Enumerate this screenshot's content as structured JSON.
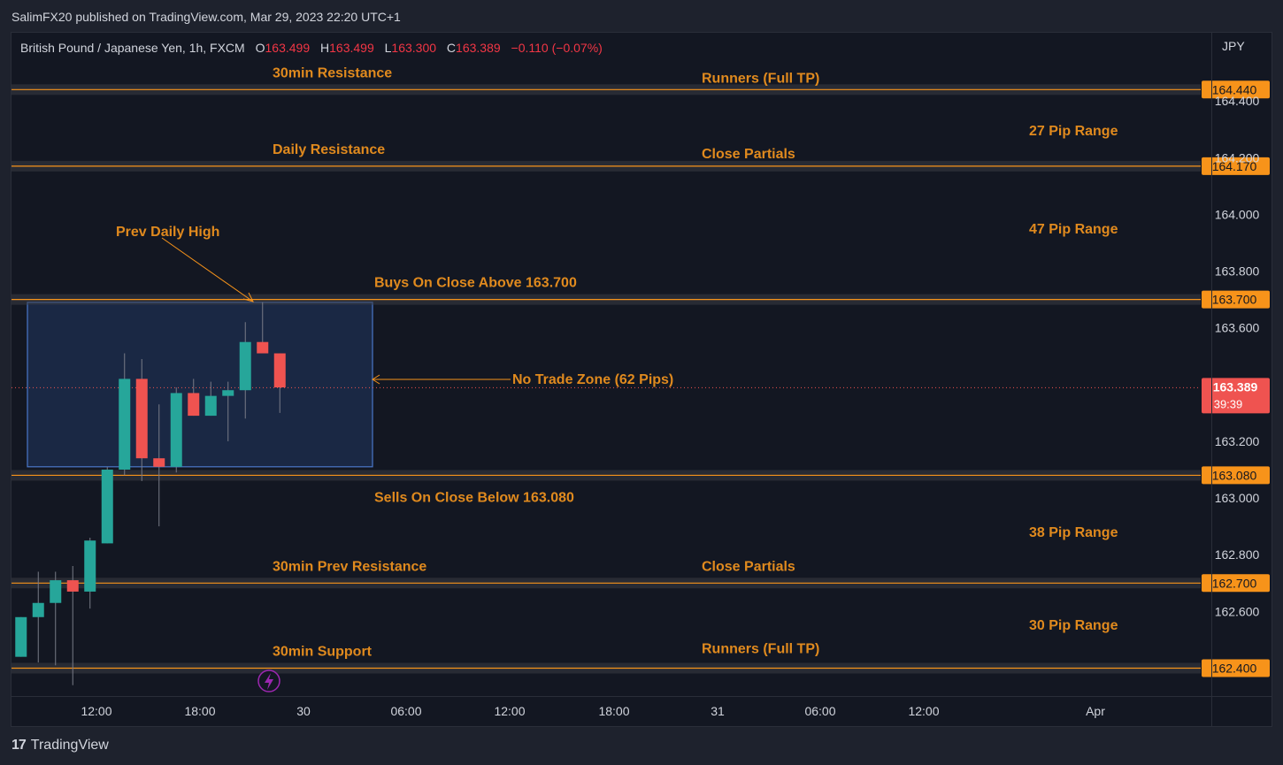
{
  "header": {
    "published": "SalimFX20 published on TradingView.com, Mar 29, 2023 22:20 UTC+1"
  },
  "legend": {
    "symbol": "British Pound / Japanese Yen, 1h, FXCM",
    "o_label": "O",
    "o_value": "163.499",
    "h_label": "H",
    "h_value": "163.499",
    "l_label": "L",
    "l_value": "163.300",
    "c_label": "C",
    "c_value": "163.389",
    "change": "−0.110 (−0.07%)"
  },
  "currency": "JPY",
  "footer": {
    "brand": "TradingView",
    "logo_mark": "17"
  },
  "colors": {
    "background": "#131722",
    "up": "#26a69a",
    "down": "#ef5350",
    "level_line": "#f7931a",
    "annotation": "#e08a1e",
    "zone_border": "#4a77c9",
    "zone_fill": "#1c2c4a",
    "price_tag": "#ef5350",
    "axis_text": "#d1d4dc"
  },
  "chart_data": {
    "type": "candlestick",
    "symbol": "GBPJPY",
    "timeframe": "1h",
    "ylim": [
      162.28,
      164.55
    ],
    "x_ticks": [
      "12:00",
      "18:00",
      "30",
      "06:00",
      "12:00",
      "18:00",
      "31",
      "06:00",
      "12:00",
      "Apr"
    ],
    "y_ticks": [
      "164.400",
      "164.200",
      "164.000",
      "163.800",
      "163.600",
      "163.200",
      "163.000",
      "162.800",
      "162.600"
    ],
    "candles": [
      {
        "o": 162.44,
        "h": 162.58,
        "l": 162.44,
        "c": 162.58
      },
      {
        "o": 162.58,
        "h": 162.74,
        "l": 162.42,
        "c": 162.63
      },
      {
        "o": 162.63,
        "h": 162.74,
        "l": 162.41,
        "c": 162.71
      },
      {
        "o": 162.71,
        "h": 162.76,
        "l": 162.34,
        "c": 162.67
      },
      {
        "o": 162.67,
        "h": 162.86,
        "l": 162.61,
        "c": 162.85
      },
      {
        "o": 162.84,
        "h": 163.11,
        "l": 162.84,
        "c": 163.1
      },
      {
        "o": 163.1,
        "h": 163.51,
        "l": 163.08,
        "c": 163.42
      },
      {
        "o": 163.42,
        "h": 163.49,
        "l": 163.06,
        "c": 163.14
      },
      {
        "o": 163.14,
        "h": 163.33,
        "l": 162.9,
        "c": 163.11
      },
      {
        "o": 163.11,
        "h": 163.39,
        "l": 163.09,
        "c": 163.37
      },
      {
        "o": 163.37,
        "h": 163.42,
        "l": 163.29,
        "c": 163.29
      },
      {
        "o": 163.29,
        "h": 163.41,
        "l": 163.29,
        "c": 163.36
      },
      {
        "o": 163.36,
        "h": 163.41,
        "l": 163.2,
        "c": 163.38
      },
      {
        "o": 163.38,
        "h": 163.62,
        "l": 163.28,
        "c": 163.55
      },
      {
        "o": 163.55,
        "h": 163.69,
        "l": 163.52,
        "c": 163.51
      },
      {
        "o": 163.51,
        "h": 163.51,
        "l": 163.3,
        "c": 163.39
      }
    ],
    "current_price": "163.389",
    "countdown": "39:39",
    "levels": [
      {
        "price": 164.44,
        "label": "164.440",
        "left_text": "30min Resistance",
        "right_text": "Runners (Full TP)"
      },
      {
        "price": 164.17,
        "label": "164.170",
        "left_text": "Daily Resistance",
        "right_text": "Close Partials"
      },
      {
        "price": 163.7,
        "label": "163.700",
        "left_text": "Buys On Close Above 163.700",
        "right_text": ""
      },
      {
        "price": 163.08,
        "label": "163.080",
        "left_text": "Sells On Close Below 163.080",
        "right_text": ""
      },
      {
        "price": 162.7,
        "label": "162.700",
        "left_text": "30min Prev Resistance",
        "right_text": "Close Partials"
      },
      {
        "price": 162.4,
        "label": "162.400",
        "left_text": "30min Support",
        "right_text": "Runners (Full TP)"
      }
    ],
    "ranges": [
      "27 Pip Range",
      "47 Pip Range",
      "38 Pip Range",
      "30 Pip Range"
    ],
    "annotations": {
      "prev_daily_high": "Prev Daily High",
      "no_trade_zone": "No Trade Zone (62 Pips)"
    },
    "zone": {
      "top": 163.69,
      "bottom": 163.11
    }
  }
}
